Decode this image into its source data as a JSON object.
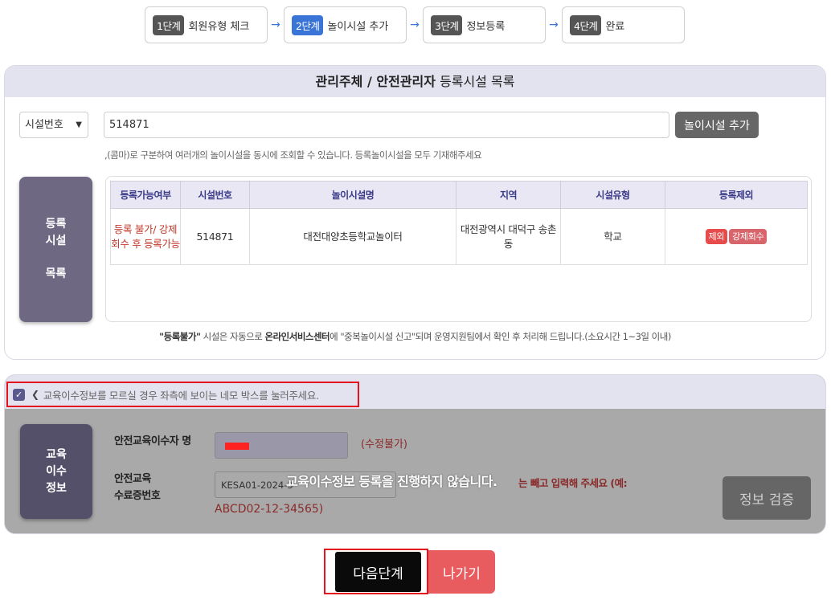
{
  "steps": [
    {
      "badge": "1단계",
      "label": "회원유형 체크"
    },
    {
      "badge": "2단계",
      "label": "놀이시설 추가"
    },
    {
      "badge": "3단계",
      "label": "정보등록"
    },
    {
      "badge": "4단계",
      "label": "완료"
    }
  ],
  "arrow": "→",
  "facility_panel": {
    "title_bold": "관리주체 / 안전관리자",
    "title_rest": " 등록시설 목록",
    "select_value": "시설번호",
    "search_value": "514871",
    "add_button": "놀이시설 추가",
    "hint": ",(콤마)로 구분하여 여러개의 놀이시설을 동시에 조회할 수 있습니다. 등록놀이시설을 모두 기재해주세요",
    "side_line1": "등록",
    "side_line2": "시설",
    "side_line3": "목록",
    "table": {
      "headers": [
        "등록가능여부",
        "시설번호",
        "놀이시설명",
        "지역",
        "시설유형",
        "등록제외"
      ],
      "row": {
        "status": "등록 불가/ 강제회수 후 등록가능",
        "number": "514871",
        "name": "대전대양초등학교놀이터",
        "region": "대전광역시 대덕구 송촌동",
        "type": "학교",
        "tag_exclude": "제외",
        "tag_force": "강제회수"
      }
    },
    "footnote_b1": "\"등록불가\"",
    "footnote_t1": " 시설은 자동으로 ",
    "footnote_b2": "온라인서비스센터",
    "footnote_t2": "에 \"중복놀이시설 신고\"되며 운영지원팀에서 확인 후 처리해 드립니다.(소요시간 1~3일 이내)"
  },
  "education_panel": {
    "checkbox_text": "교육이수정보를 모르실 경우 좌측에 보이는 네모 박스를 눌러주세요.",
    "side_line1": "교육",
    "side_line2": "이수",
    "side_line3": "정보",
    "name_label": "안전교육이수자 명",
    "no_edit": "(수정불가)",
    "cert_label_1": "안전교육",
    "cert_label_2": "수료증번호",
    "cert_value": "KESA01-2024-3",
    "cert_note": "는 빼고 입력해 주세요 (예:",
    "cert_example": "ABCD02-12-34565)",
    "overlay_message": "교육이수정보 등록을 진행하지 않습니다.",
    "verify_button": "정보 검증"
  },
  "bottom": {
    "next_button": "다음단계",
    "exit_button": "나가기"
  },
  "colors": {
    "accent": "#3a74d6",
    "highlight_border": "#e3141d",
    "exit": "#e85b5f"
  }
}
